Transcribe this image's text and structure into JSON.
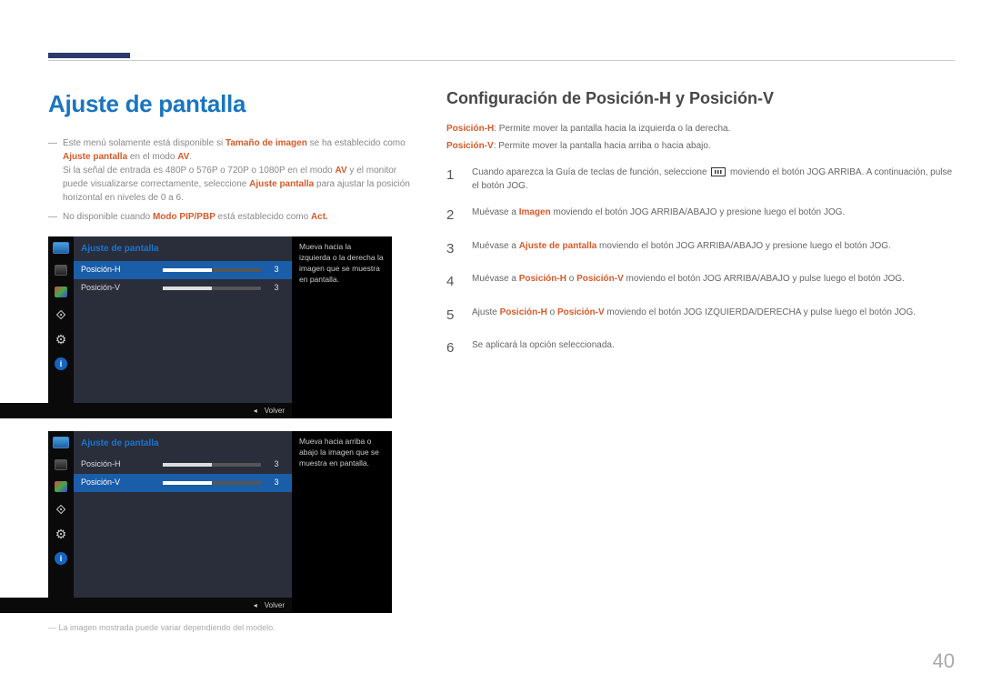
{
  "page_number": "40",
  "left": {
    "heading": "Ajuste de pantalla",
    "notes": {
      "n1_pre": "Este menú solamente está disponible si ",
      "n1_strong1": "Tamaño de imagen",
      "n1_mid": " se ha establecido como ",
      "n1_strong2": "Ajuste pantalla",
      "n1_mid2": " en el modo ",
      "n1_strong3": "AV",
      "n1_end": ".",
      "n1b_pre": "Si la señal de entrada es 480P o 576P o 720P o 1080P en el modo ",
      "n1b_strong1": "AV",
      "n1b_mid": " y el monitor puede visualizarse correctamente, seleccione ",
      "n1b_strong2": "Ajuste pantalla",
      "n1b_end": " para ajustar la posición horizontal en niveles de 0 a 6.",
      "n2_pre": "No disponible cuando ",
      "n2_strong1": "Modo PIP/PBP",
      "n2_mid": " está establecido como ",
      "n2_strong2": "Act.",
      "n2_end": ""
    },
    "osd": {
      "title": "Ajuste de pantalla",
      "pos_h": "Posición-H",
      "pos_v": "Posición-V",
      "val_h": "3",
      "val_v": "3",
      "desc_h": "Mueva hacia la izquierda o la derecha la imagen que se muestra en pantalla.",
      "desc_v": "Mueva hacia arriba o abajo la imagen que se muestra en pantalla.",
      "back": "Volver",
      "info_glyph": "i"
    },
    "footnote": "La imagen mostrada puede variar dependiendo del modelo."
  },
  "right": {
    "heading": "Configuración de Posición-H y Posición-V",
    "def_h_label": "Posición-H",
    "def_h_text": ": Permite mover la pantalla hacia la izquierda o la derecha.",
    "def_v_label": "Posición-V",
    "def_v_text": ": Permite mover la pantalla hacia arriba o hacia abajo.",
    "steps": {
      "s1_a": "Cuando aparezca la Guía de teclas de función, seleccione ",
      "s1_b": " moviendo el botón JOG ARRIBA. A continuación, pulse el botón JOG.",
      "s2_a": "Muévase a ",
      "s2_strong": "Imagen",
      "s2_b": " moviendo el botón JOG ARRIBA/ABAJO y presione luego el botón JOG.",
      "s3_a": "Muévase a ",
      "s3_strong": "Ajuste de pantalla",
      "s3_b": " moviendo el botón JOG ARRIBA/ABAJO y presione luego el botón JOG.",
      "s4_a": "Muévase a ",
      "s4_strong1": "Posición-H",
      "s4_mid": " o ",
      "s4_strong2": "Posición-V",
      "s4_b": " moviendo el botón JOG ARRIBA/ABAJO y pulse luego el botón JOG.",
      "s5_a": "Ajuste ",
      "s5_strong1": "Posición-H",
      "s5_mid": " o ",
      "s5_strong2": "Posición-V",
      "s5_b": " moviendo el botón JOG IZQUIERDA/DERECHA y pulse luego el botón JOG.",
      "s6": "Se aplicará la opción seleccionada."
    },
    "nums": {
      "n1": "1",
      "n2": "2",
      "n3": "3",
      "n4": "4",
      "n5": "5",
      "n6": "6"
    }
  }
}
